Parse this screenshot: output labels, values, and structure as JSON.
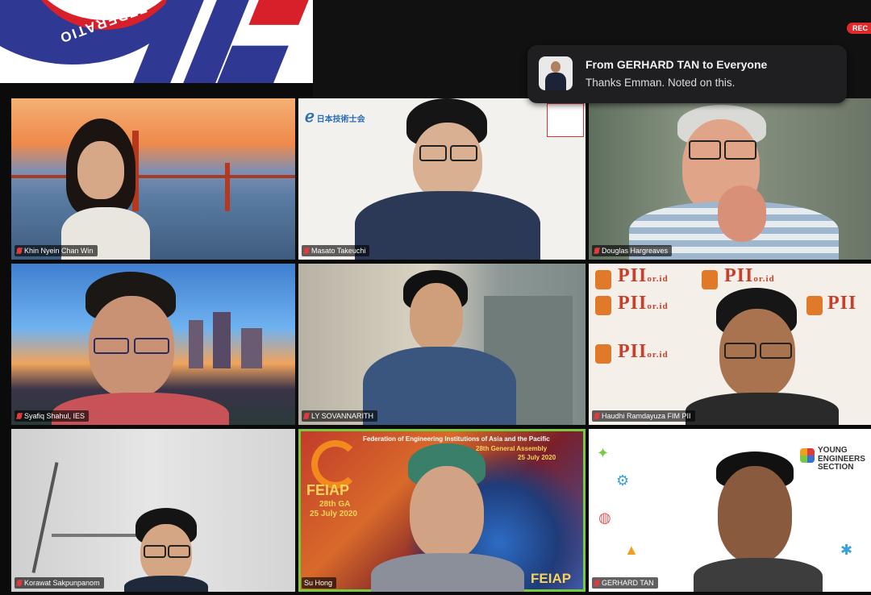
{
  "recording_badge": "REC",
  "chat_notification": {
    "title": "From GERHARD TAN to Everyone",
    "message": "Thanks Emman. Noted on this."
  },
  "logo": {
    "arc_text": "FEDERATIO"
  },
  "participants": [
    {
      "name": "Khin Nyein Chan Win",
      "muted": true,
      "background": "Golden Gate Bridge at sunset"
    },
    {
      "name": "Masato Takeuchi",
      "muted": true,
      "background": "white wall with poster"
    },
    {
      "name": "Douglas Hargreaves",
      "muted": true,
      "background": "room"
    },
    {
      "name": "Syafiq Shahul, IES",
      "muted": true,
      "background": "city skyline"
    },
    {
      "name": "LY SOVANNARITH",
      "muted": true,
      "background": "office"
    },
    {
      "name": "Haudhi Ramdayuza FIM PII",
      "muted": true,
      "background": "PII logo wall"
    },
    {
      "name": "Korawat Sakpunpanom",
      "muted": true,
      "background": "home gym"
    },
    {
      "name": "Su Hong",
      "muted": false,
      "active_speaker": true,
      "background": "FEIAP banner"
    },
    {
      "name": "GERHARD TAN",
      "muted": true,
      "background": "Young Engineers Section"
    }
  ],
  "backgrounds": {
    "pii_logo": "PII",
    "pii_suffix": "or.id",
    "masato_sign": "日本技術士会",
    "feiap_banner": {
      "header": "Federation of Engineering Institutions of Asia and the Pacific",
      "assembly_line1": "28th General Assembly",
      "assembly_line2": "25 July 2020",
      "name": "FEIAP",
      "ga_line": "28th GA",
      "date": "25 July 2020",
      "footer_logo": "FEIAP"
    },
    "young_engineers": [
      "YOUNG",
      "ENGINEERS",
      "SECTION"
    ]
  },
  "colors": {
    "active_border": "#7ac943",
    "rec": "#e02a2a",
    "brand_blue": "#2f3893",
    "brand_red": "#d8202a"
  }
}
